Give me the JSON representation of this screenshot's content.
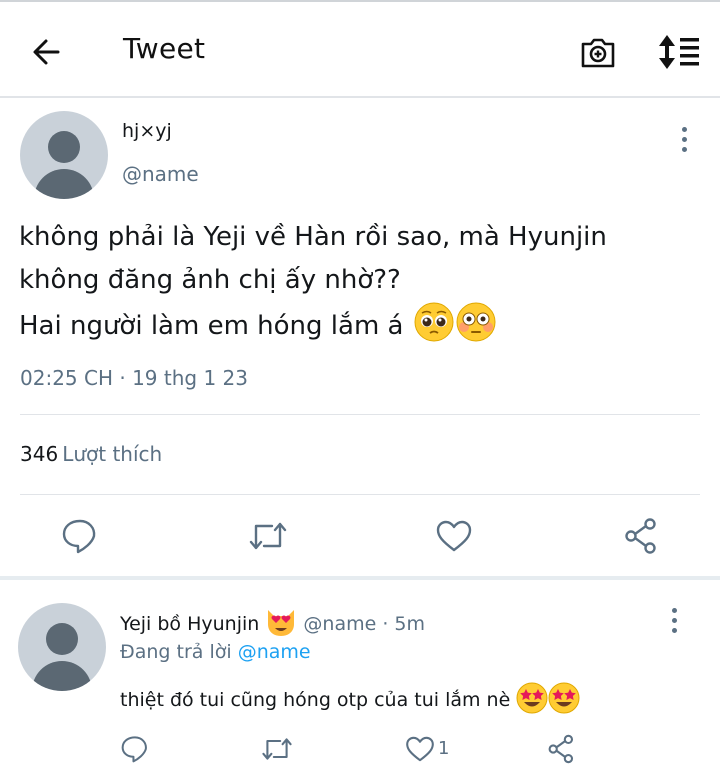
{
  "header": {
    "title": "Tweet",
    "icons": [
      "back-arrow-icon",
      "camera-add-icon",
      "sort-lines-icon"
    ]
  },
  "tweet": {
    "display_name": "hj×yj",
    "handle": "@name",
    "text": "không phải là Yeji về Hàn rồi sao,  mà Hyunjin\nkhông đăng ảnh chị ấy nhờ??\nHai người làm em hóng lắm á",
    "text_emojis": [
      "pleading-face",
      "flushed-face"
    ],
    "timestamp": "02:25 CH · 19 thg 1 23",
    "likes_count": "346",
    "likes_label": "Lượt thích",
    "actions": [
      "reply-icon",
      "retweet-icon",
      "like-icon",
      "share-icon"
    ]
  },
  "reply": {
    "display_name": "Yeji bồ Hyunjin",
    "name_emoji": "heart-eyes-cat",
    "handle": "@name",
    "time": "· 5m",
    "replying_prefix": "Đang trả lời",
    "replying_to": "@name",
    "text": "thiệt đó tui cũng hóng otp của tui lắm nè",
    "text_emojis": [
      "star-struck",
      "star-struck"
    ],
    "like_count": "1",
    "actions": [
      "reply-icon",
      "retweet-icon",
      "like-icon",
      "share-icon"
    ]
  },
  "colors": {
    "text": "#14171a",
    "secondary": "#5b7083",
    "link": "#1da1f2",
    "divider": "#e1e4e8",
    "avatar_bg": "#c9d1d9",
    "avatar_fg": "#5b6873"
  }
}
